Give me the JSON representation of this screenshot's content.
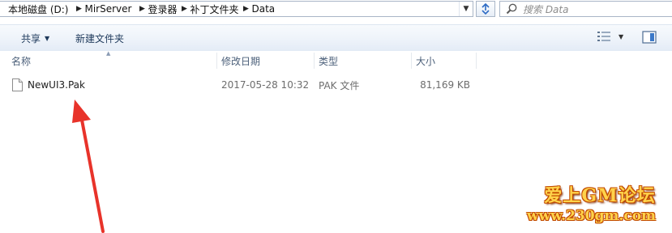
{
  "address_bar": {
    "breadcrumbs": [
      {
        "label": "本地磁盘 (D:)"
      },
      {
        "label": "MirServer"
      },
      {
        "label": "登录器"
      },
      {
        "label": "补丁文件夹"
      },
      {
        "label": "Data"
      }
    ]
  },
  "search": {
    "placeholder": "搜索 Data"
  },
  "command_bar": {
    "share_label": "共享",
    "new_folder_label": "新建文件夹"
  },
  "columns": {
    "name": "名称",
    "date_modified": "修改日期",
    "type": "类型",
    "size": "大小"
  },
  "files": [
    {
      "name": "NewUI3.Pak",
      "date_modified": "2017-05-28 10:32",
      "type": "PAK 文件",
      "size": "81,169 KB"
    }
  ],
  "watermark": {
    "title": "爱上GM论坛",
    "url": "www.230gm.com"
  },
  "colors": {
    "annotation_arrow": "#e8332a",
    "watermark_fill": "#ffd24a",
    "watermark_outline": "#c24a00"
  }
}
